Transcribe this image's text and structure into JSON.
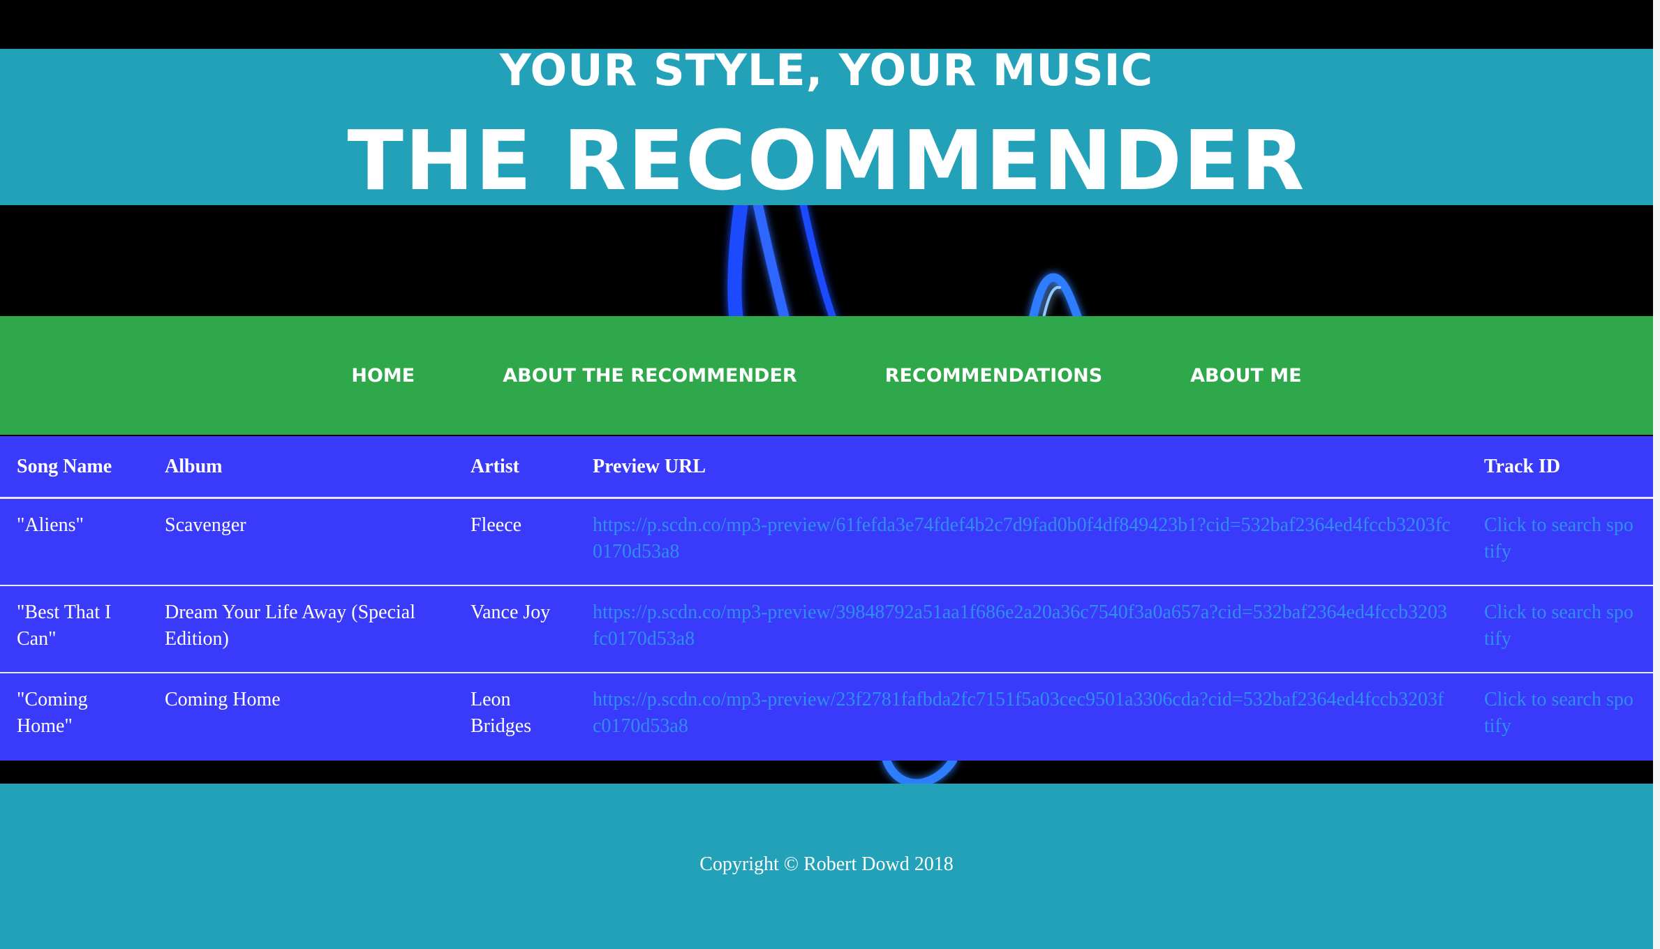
{
  "header": {
    "tagline": "YOUR STYLE, YOUR MUSIC",
    "title": "THE RECOMMENDER"
  },
  "nav": {
    "items": [
      {
        "label": "HOME"
      },
      {
        "label": "ABOUT THE RECOMMENDER"
      },
      {
        "label": "RECOMMENDATIONS"
      },
      {
        "label": "ABOUT ME"
      }
    ]
  },
  "table": {
    "headers": [
      "Song Name",
      "Album",
      "Artist",
      "Preview URL",
      "Track ID"
    ],
    "rows": [
      {
        "song": "\"Aliens\"",
        "album": "Scavenger",
        "artist": "Fleece",
        "preview_url": "https://p.scdn.co/mp3-preview/61fefda3e74fdef4b2c7d9fad0b0f4df849423b1?cid=532baf2364ed4fccb3203fc0170d53a8",
        "track_id": "Click to search spotify"
      },
      {
        "song": "\"Best That I Can\"",
        "album": "Dream Your Life Away (Special Edition)",
        "artist": "Vance Joy",
        "preview_url": "https://p.scdn.co/mp3-preview/39848792a51aa1f686e2a20a36c7540f3a0a657a?cid=532baf2364ed4fccb3203fc0170d53a8",
        "track_id": "Click to search spotify"
      },
      {
        "song": "\"Coming Home\"",
        "album": "Coming Home",
        "artist": "Leon Bridges",
        "preview_url": "https://p.scdn.co/mp3-preview/23f2781fafbda2fc7151f5a03cec9501a3306cda?cid=532baf2364ed4fccb3203fc0170d53a8",
        "track_id": "Click to search spotify"
      }
    ]
  },
  "footer": {
    "copyright": "Copyright © Robert Dowd 2018"
  },
  "colors": {
    "header_bg": "#22a1b8",
    "nav_bg": "#2ea84a",
    "table_bg": "#3a3afa",
    "link": "#2f8ef0",
    "text": "#ffffff",
    "background": "#000000"
  }
}
